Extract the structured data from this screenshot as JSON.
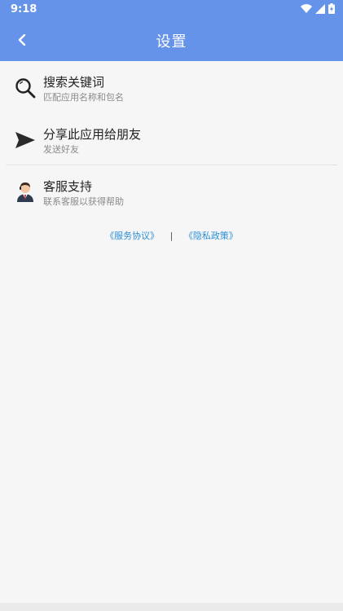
{
  "status": {
    "time": "9:18"
  },
  "header": {
    "title": "设置",
    "back_icon": "chevron-left-icon",
    "background": "#6593ea"
  },
  "items": [
    {
      "label": "搜索关键词",
      "sub": "匹配应用名称和包名",
      "icon": "search-icon"
    },
    {
      "label": "分享此应用给朋友",
      "sub": "发送好友",
      "icon": "send-icon"
    },
    {
      "label": "客服支持",
      "sub": "联系客服以获得帮助",
      "icon": "support-agent-icon"
    }
  ],
  "links": {
    "service": "《服务协议》",
    "separator": "|",
    "privacy": "《隐私政策》",
    "color": "#2b8fd6"
  }
}
